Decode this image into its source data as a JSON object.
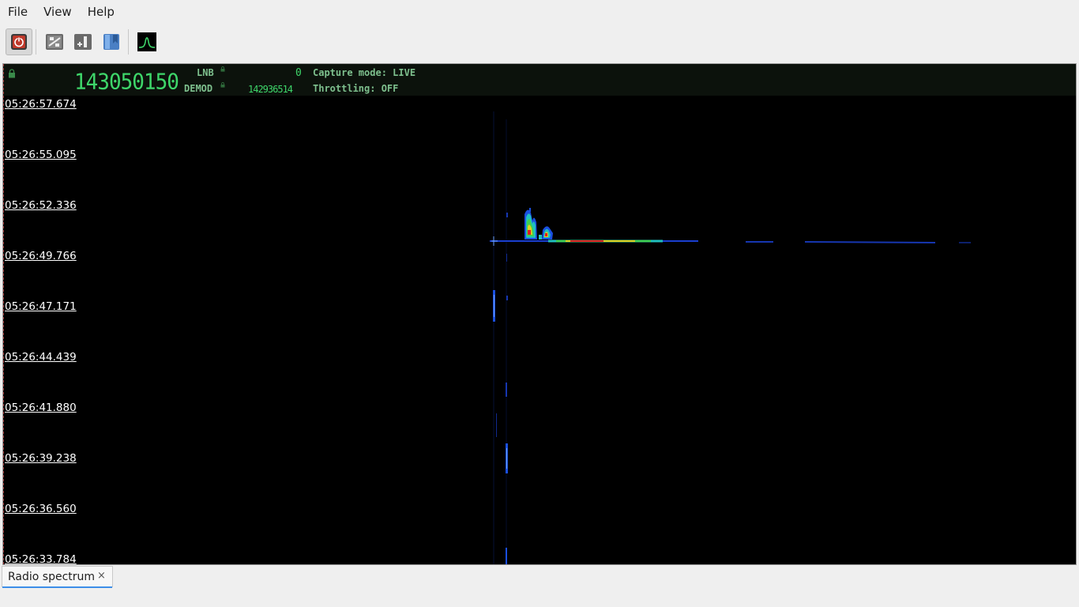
{
  "menu": {
    "items": [
      "File",
      "View",
      "Help"
    ]
  },
  "toolbar": {
    "buttons": [
      {
        "name": "power-button",
        "icon": "power-icon",
        "pressed": true
      },
      {
        "name": "settings-button",
        "icon": "sliders-icon"
      },
      {
        "name": "add-button",
        "icon": "add-panel-icon"
      },
      {
        "name": "bookmark-button",
        "icon": "bookmark-icon"
      },
      {
        "name": "spectrum-button",
        "icon": "spectrum-icon"
      }
    ]
  },
  "header": {
    "frequency": "143050150",
    "lnb_label": "LNB",
    "demod_label": "DEMOD",
    "lnb_value": "0",
    "demod_value": "142936514",
    "capture_mode": "Capture mode: LIVE",
    "throttling": "Throttling: OFF"
  },
  "waterfall": {
    "timestamps": [
      "05:26:57.674",
      "05:26:55.095",
      "05:26:52.336",
      "05:26:49.766",
      "05:26:47.171",
      "05:26:44.439",
      "05:26:41.880",
      "05:26:39.238",
      "05:26:36.560",
      "05:26:33.784"
    ]
  },
  "tabs": [
    {
      "label": "Radio spectrum",
      "close": "×"
    }
  ],
  "colors": {
    "lcd": "#3ed66a",
    "label": "#7ec08e",
    "accent": "#3d8ee8",
    "background": "#000000"
  }
}
